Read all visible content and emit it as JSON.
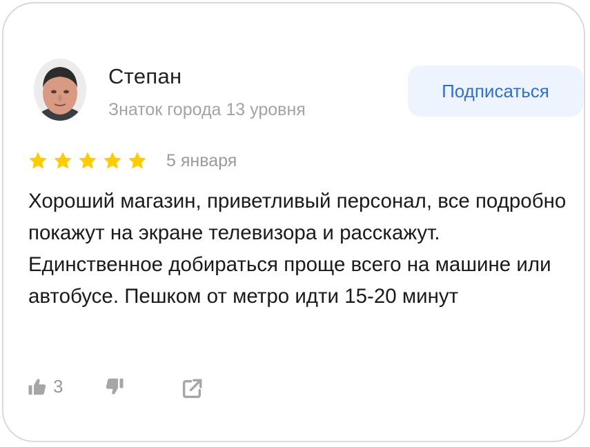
{
  "author": {
    "name": "Степан",
    "level": "Знаток города 13 уровня"
  },
  "subscribe_label": "Подписаться",
  "review": {
    "rating": 5,
    "rating_max": 5,
    "date": "5 января",
    "text": "Хороший магазин, приветливый персонал, все подробно покажут на экране телевизора и расскажут. Единственное добираться проще всего на машине или автобусе. Пешком от метро идти 15-20 минут"
  },
  "actions": {
    "likes_count": "3"
  },
  "colors": {
    "accent": "#2e6fd6",
    "subscribe_bg": "#eef4fd",
    "star": "#ffcc00",
    "muted": "#a3a3a3",
    "icon": "#a6a6a6"
  },
  "icons": [
    "avatar",
    "star-icon",
    "thumbs-up-icon",
    "thumbs-down-icon",
    "share-icon"
  ]
}
